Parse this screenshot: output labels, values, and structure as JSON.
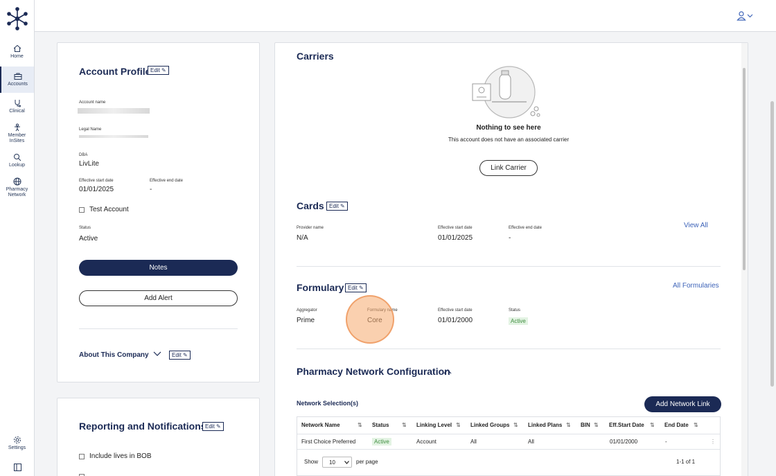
{
  "nav": {
    "home": "Home",
    "accounts": "Accounts",
    "clinical": "Clinical",
    "member_line1": "Member",
    "member_line2": "InSites",
    "lookup": "Lookup",
    "pharmacy_line1": "Pharmacy",
    "pharmacy_line2": "Network",
    "settings": "Settings"
  },
  "account_profile": {
    "title": "Account Profile",
    "edit": "Edit",
    "account_name_label": "Account name",
    "legal_name_label": "Legal Name",
    "dba_label": "DBA",
    "dba_value": "LivLite",
    "eff_start_label": "Effective start date",
    "eff_start_value": "01/01/2025",
    "eff_end_label": "Effective end date",
    "eff_end_value": "-",
    "test_account": "Test Account",
    "status_label": "Status",
    "status_value": "Active",
    "notes": "Notes",
    "add_alert": "Add Alert",
    "about": "About This Company",
    "about_edit": "Edit"
  },
  "reporting": {
    "title": "Reporting and Notifications",
    "edit": "Edit",
    "include_lives": "Include lives in BOB"
  },
  "carriers": {
    "title": "Carriers",
    "empty_title": "Nothing to see here",
    "empty_text": "This account does not have an associated carrier",
    "link_carrier": "Link Carrier"
  },
  "cards": {
    "title": "Cards",
    "edit": "Edit",
    "provider_label": "Provider name",
    "provider_value": "N/A",
    "eff_start_label": "Effective start date",
    "eff_start_value": "01/01/2025",
    "eff_end_label": "Effective end date",
    "eff_end_value": "-",
    "view_all": "View All"
  },
  "formulary": {
    "title": "Formulary",
    "edit": "Edit",
    "all_formularies": "All Formularies",
    "aggregator_label": "Aggregator",
    "aggregator_value": "Prime",
    "formulary_name_label": "Formulary name",
    "formulary_name_value": "Core",
    "eff_start_label": "Effective start date",
    "eff_start_value": "01/01/2000",
    "status_label": "Status",
    "status_value": "Active"
  },
  "pharmacy_network": {
    "title": "Pharmacy Network Configuration",
    "network_selection": "Network Selection(s)",
    "add_link": "Add Network Link",
    "columns": [
      "Network Name",
      "Status",
      "Linking Level",
      "Linked Groups",
      "Linked Plans",
      "BIN",
      "Eff.Start Date",
      "End Date"
    ],
    "row": {
      "network_name": "First Choice Preferred",
      "status": "Active",
      "linking_level": "Account",
      "linked_groups": "All",
      "linked_plans": "All",
      "bin": "",
      "eff_start": "01/01/2000",
      "end_date": "-"
    },
    "show": "Show",
    "per_page_value": "10",
    "per_page": "per page",
    "pagination": "1-1 of 1"
  },
  "colors": {
    "navy": "#1b2a55",
    "link": "#3d63b8",
    "active_badge_bg": "#e3f3e3",
    "active_badge_text": "#3f8d3f"
  }
}
